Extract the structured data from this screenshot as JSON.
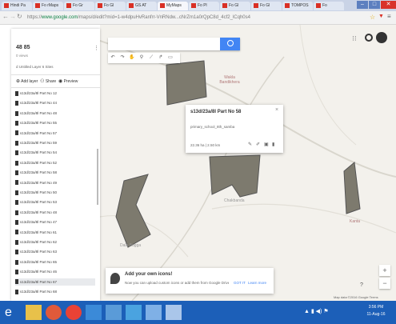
{
  "browser": {
    "tabs": [
      "Hindi Pa",
      "Fo rMaps",
      "Fo Gr",
      "Fo Gl",
      "GS AT",
      "MyMaps",
      "Fo Pl",
      "Fo Gl",
      "Fo Gl",
      "TOMPOS",
      "Fo"
    ],
    "url_prefix": "https://",
    "url_host": "www.google.com",
    "url_path": "/maps/d/edit?mid=1-w4dpuHvRanfrr-VnRNdw...cNrZm1a0rQpC8d_4cf2_lCqh0s4"
  },
  "panel": {
    "title": "48 85",
    "subtitle": "0 views",
    "description": "d Untitled Layer 6 Sites",
    "actions": [
      "Add layer",
      "Share",
      "Preview"
    ],
    "layers": [
      "s13d/23a/8l Part No 12",
      "s13d/23a/8l Part No 44",
      "s13d/23a/8l Part No 48",
      "s13d/23a/8l Part No 55",
      "s13d/23a/8l Part No 57",
      "s13d/23a/8l Part No 59",
      "s13d/23a/8l Part No 54",
      "s13d/23a/8l Part No 52",
      "s13d/23a/8l Part No 58",
      "s13d/23a/8l Part No 49",
      "s13d/23a/8l Part No 50",
      "s13d/23a/8l Part No 53",
      "s13d/23a/8l Part No 48",
      "s13d/23a/8l Part No 47",
      "s13d/23a/8l Part No 61",
      "s13d/23a/8l Part No 62",
      "s13d/23a/8l Part No 63",
      "s13d/23a/8l Part No 65",
      "s13d/23a/8l Part No 46",
      "s13d/23a/8l Part No 67",
      "s13d/23a/8l Part No 68"
    ]
  },
  "map": {
    "labels": {
      "village_top": "Wakla Bandikhera",
      "village_mid": "Chakbanda",
      "village_left": "Dala Bugga",
      "village_right": "Kanta"
    },
    "attribution": "Map data ©2016 Google  Terms"
  },
  "info_card": {
    "title": "s13d/23a/8l Part No 58",
    "description": "primary_school_8th_samba",
    "meta": "22.36 ha  |  2.50 km"
  },
  "toast": {
    "title": "Add your own icons!",
    "body": "Now you can upload custom icons or add them from Google Drive.",
    "got_it": "GOT IT",
    "learn_more": "Learn more"
  },
  "taskbar": {
    "clock_time": "3:56 PM",
    "clock_date": "11-Aug-16"
  },
  "colors": {
    "accent": "#4285f4",
    "taskbar": "#1c5fb8",
    "polygon": "#7d7a6e"
  }
}
